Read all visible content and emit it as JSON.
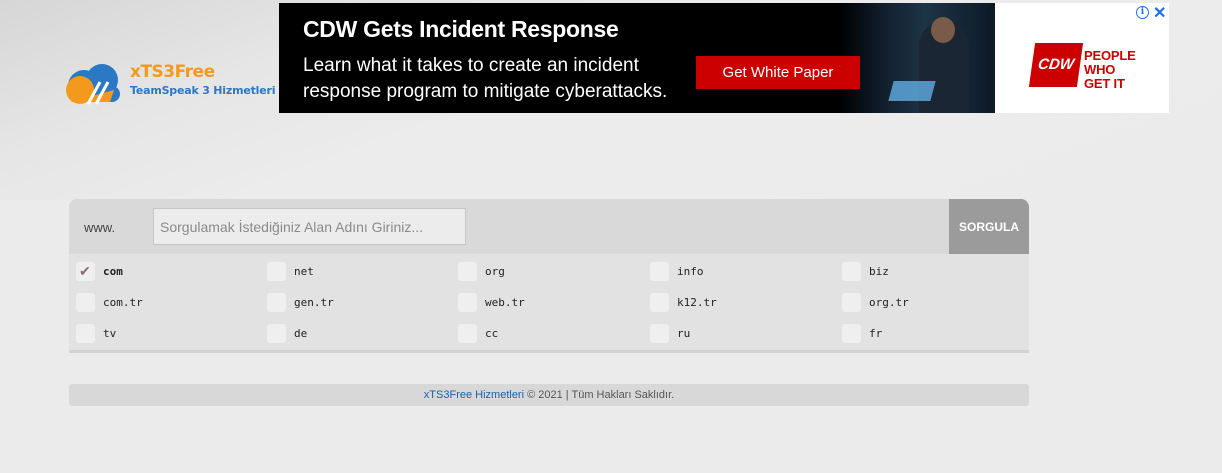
{
  "logo": {
    "title": "xTS3Free",
    "subtitle": "TeamSpeak 3 Hizmetleri"
  },
  "ad": {
    "headline": "CDW Gets Incident Response",
    "body": "Learn what it takes to create an incident response program to mitigate cyberattacks.",
    "cta": "Get White Paper",
    "brand": "CDW",
    "slogan_line1": "PEOPLE",
    "slogan_line2": "WHO",
    "slogan_line3": "GET IT",
    "info_glyph": "i",
    "close_glyph": "✕"
  },
  "search": {
    "prefix": "www.",
    "placeholder": "Sorgulamak İstediğiniz Alan Adını Giriniz...",
    "value": "",
    "button_label": "SORGULA"
  },
  "tlds": [
    {
      "label": "com",
      "checked": true
    },
    {
      "label": "net",
      "checked": false
    },
    {
      "label": "org",
      "checked": false
    },
    {
      "label": "info",
      "checked": false
    },
    {
      "label": "biz",
      "checked": false
    },
    {
      "label": "com.tr",
      "checked": false
    },
    {
      "label": "gen.tr",
      "checked": false
    },
    {
      "label": "web.tr",
      "checked": false
    },
    {
      "label": "k12.tr",
      "checked": false
    },
    {
      "label": "org.tr",
      "checked": false
    },
    {
      "label": "tv",
      "checked": false
    },
    {
      "label": "de",
      "checked": false
    },
    {
      "label": "cc",
      "checked": false
    },
    {
      "label": "ru",
      "checked": false
    },
    {
      "label": "fr",
      "checked": false
    }
  ],
  "footer": {
    "link_text": "xTS3Free Hizmetleri",
    "copyright": " © 2021 | Tüm Hakları Saklıdır."
  },
  "colors": {
    "accent_orange": "#f39a1c",
    "accent_blue": "#2b78c4",
    "cdw_red": "#cc0000",
    "button_gray": "#9b9b9b"
  }
}
